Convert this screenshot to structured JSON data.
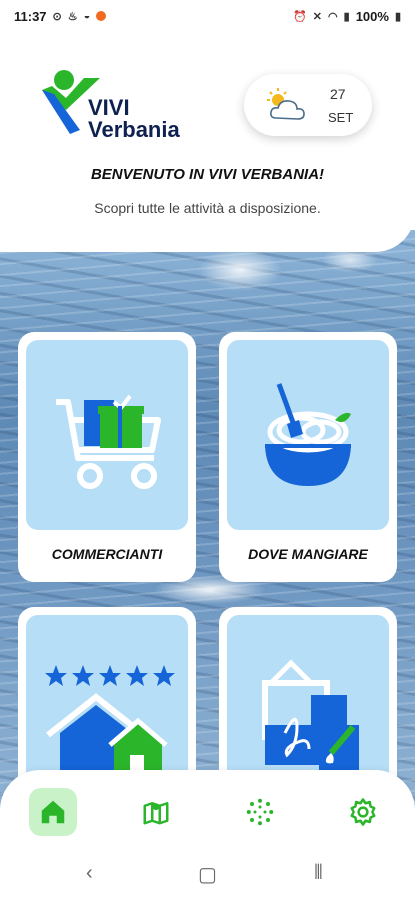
{
  "status_bar": {
    "time": "11:37",
    "battery": "100%"
  },
  "brand": {
    "name_line1": "VIVI",
    "name_line2": "Verbania",
    "green": "#2bb52b",
    "blue": "#1565d8",
    "navy": "#0e2150"
  },
  "weather": {
    "icon": "partly-cloudy-icon",
    "day": "27",
    "month": "SET"
  },
  "welcome": {
    "title": "BENVENUTO IN VIVI VERBANIA!",
    "subtitle": "Scopri tutte le attività a disposizione."
  },
  "cards": [
    {
      "label": "COMMERCIANTI",
      "icon": "shopping-cart-icon"
    },
    {
      "label": "DOVE MANGIARE",
      "icon": "food-bowl-icon"
    },
    {
      "label": "",
      "icon": "rated-house-icon"
    },
    {
      "label": "",
      "icon": "art-frames-icon"
    }
  ],
  "bottom_nav": [
    {
      "icon": "home-icon",
      "active": true
    },
    {
      "icon": "map-icon",
      "active": false
    },
    {
      "icon": "dots-circle-icon",
      "active": false
    },
    {
      "icon": "settings-icon",
      "active": false
    }
  ],
  "system_nav": [
    "back",
    "home",
    "recents"
  ]
}
